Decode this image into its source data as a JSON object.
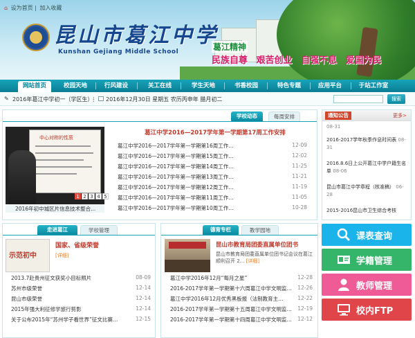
{
  "topbar": {
    "home": "设为首页",
    "sep": "|",
    "fav": "加入收藏"
  },
  "header": {
    "school_name": "昆山市葛江中学",
    "school_en": "Kunshan Gejiang Middle School",
    "spirit_title": "葛江精神",
    "spirit_mottos": [
      "民族自尊",
      "艰苦创业",
      "自强不息",
      "爱国为民"
    ]
  },
  "nav": {
    "items": [
      "网站首页",
      "校园天地",
      "行风建设",
      "关工在线",
      "学生天地",
      "书香校园",
      "特色专题",
      "应用平台",
      "于站工作室"
    ]
  },
  "infobar": {
    "ticker": "2016年葛江中学初一（学区生）报",
    "date": "2016年12月30日  星期五  农历丙申年  腊月初二",
    "search_placeholder": "",
    "search_button": "搜索"
  },
  "center_top": {
    "tabs": [
      "学校动态",
      "每周安排"
    ],
    "feature_title": "葛江中学2016—2017学年第一学期第17周工作安排",
    "slide_caption": "2016年初中城区片信息技术整合...",
    "slide_board_title": "中心对称的性质",
    "pages": [
      "1",
      "2",
      "3",
      "4",
      "5"
    ],
    "list": [
      {
        "title": "葛江中学2016—2017学年第一学期第16周工作…",
        "date": "12-09"
      },
      {
        "title": "葛江中学2016—2017学年第一学期第15周工作…",
        "date": "12-02"
      },
      {
        "title": "葛江中学2016—2017学年第一学期第14周工作…",
        "date": "11-25"
      },
      {
        "title": "葛江中学2016—2017学年第一学期第13周工作…",
        "date": "11-21"
      },
      {
        "title": "葛江中学2016—2017学年第一学期第12周工作…",
        "date": "11-19"
      },
      {
        "title": "葛江中学2016—2017学年第一学期第11周工作…",
        "date": "11-05"
      },
      {
        "title": "葛江中学2016—2017学年第一学期第10周工作…",
        "date": "10-28"
      }
    ]
  },
  "notice": {
    "title": "通知公告",
    "more": "更多>",
    "items": [
      {
        "text": "",
        "date": "08-31"
      },
      {
        "text": "2016-2017学年秋季作息时间表",
        "date": "08-31"
      },
      {
        "text": "2016.8.6日上公开葛江中学户籍生名单",
        "date": "08-06"
      },
      {
        "text": "昆山市葛江中学章程（核准稿）",
        "date": "06-28"
      },
      {
        "text": "2015-2016昆山市卫生综合考核",
        "date": ""
      }
    ]
  },
  "bottom_left": {
    "tabs": [
      "走进葛江",
      "学校管理"
    ],
    "headline": "国家、省级荣誉",
    "detail": "[详细]",
    "thumb_text": "示范初中",
    "list": [
      {
        "title": "2013.7赴贵州征文获奖小目标照片",
        "date": "08-09"
      },
      {
        "title": "苏州市级荣誉",
        "date": "12-14"
      },
      {
        "title": "昆山市级荣誉",
        "date": "12-14"
      },
      {
        "title": "2015年强大利征修学旅行剪影",
        "date": "12-14"
      },
      {
        "title": "关于公布2015年“苏州学子看世界”征文比赛…",
        "date": "12-15"
      }
    ]
  },
  "bottom_mid": {
    "tabs": [
      "德育专栏",
      "教学园地"
    ],
    "headline": "昆山市教育局团委直属单位团书",
    "desc": "昆山市教育局团委直属单位团书记会议在葛江顺利召开 2...",
    "detail": "[详细]",
    "list": [
      {
        "title": "葛江中学2016年12月“每月之星”",
        "date": "12-28"
      },
      {
        "title": "2016-2017学年第一学期第十六周葛江中学文明监…",
        "date": "12-26"
      },
      {
        "title": "葛江中学2016年12月优秀黑板报（法制教育主…",
        "date": "12-22"
      },
      {
        "title": "2016-2017学年第一学期第十五周葛江中学文明监…",
        "date": "12-19"
      },
      {
        "title": "2016-2017学年第一学期第十四周葛江中学文明监…",
        "date": "12-12"
      }
    ]
  },
  "side_buttons": [
    {
      "label": "课表查询",
      "color": "#1ab3ea"
    },
    {
      "label": "学籍管理",
      "color": "#35b56a"
    },
    {
      "label": "教师管理",
      "color": "#ef5b97"
    },
    {
      "label": "校内FTP",
      "color": "#e0454a"
    }
  ],
  "colors": {
    "nav": "#0a7e95",
    "accent_red": "#c0392b",
    "teal": "#17a3b9"
  }
}
